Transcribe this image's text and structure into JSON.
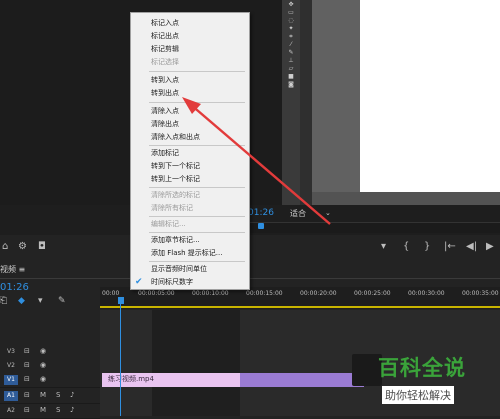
{
  "program_monitor": {
    "timecode": "01:26",
    "fit_label": "适合"
  },
  "sequence_panel": {
    "tab_label": "视频",
    "timecode": "01:26",
    "ruler_labels": [
      "00:00",
      "00:00:05:00",
      "00:00:10:00",
      "00:00:15:00",
      "00:00:20:00",
      "00:00:25:00",
      "00:00:30:00",
      "00:00:35:00"
    ],
    "tracks": [
      {
        "label": "V3",
        "active": false
      },
      {
        "label": "V2",
        "active": false
      },
      {
        "label": "V1",
        "active": true
      },
      {
        "label": "A1",
        "active": true
      },
      {
        "label": "A2",
        "active": false
      }
    ],
    "clip_name": "练习视频.mp4",
    "mute_label": "M",
    "solo_label": "S"
  },
  "context_menu": {
    "items": [
      {
        "label": "标记入点",
        "disabled": false
      },
      {
        "label": "标记出点",
        "disabled": false
      },
      {
        "label": "标记剪辑",
        "disabled": false
      },
      {
        "label": "标记选择",
        "disabled": true
      },
      {
        "label": "转到入点",
        "disabled": false
      },
      {
        "label": "转到出点",
        "disabled": false
      },
      {
        "label": "清除入点",
        "disabled": false
      },
      {
        "label": "清除出点",
        "disabled": false
      },
      {
        "label": "清除入点和出点",
        "disabled": false
      },
      {
        "label": "添加标记",
        "disabled": false
      },
      {
        "label": "转到下一个标记",
        "disabled": false
      },
      {
        "label": "转到上一个标记",
        "disabled": false
      },
      {
        "label": "清除所选的标记",
        "disabled": true
      },
      {
        "label": "清除所有标记",
        "disabled": true
      },
      {
        "label": "编辑标记...",
        "disabled": true
      },
      {
        "label": "添加章节标记...",
        "disabled": false
      },
      {
        "label": "添加 Flash 提示标记...",
        "disabled": false
      },
      {
        "label": "显示音频时间单位",
        "disabled": false
      },
      {
        "label": "时间标尺数字",
        "disabled": false,
        "checked": true
      }
    ]
  },
  "watermark": {
    "title": "百科全说",
    "subtitle": "助你轻松解决"
  },
  "colors": {
    "accent_blue": "#2f8fe0",
    "arrow_red": "#e23b3b",
    "clip_pink": "#e9c4f0",
    "clip_purple": "#9b7cd4",
    "watermark_green": "#3aa33a"
  }
}
